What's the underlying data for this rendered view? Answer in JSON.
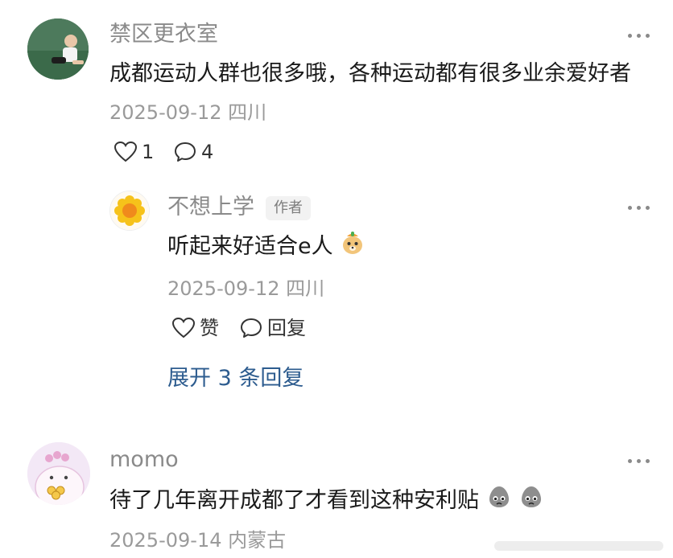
{
  "comments": [
    {
      "username": "禁区更衣室",
      "text": "成都运动人群也很多哦，各种运动都有很多业余爱好者",
      "meta": "2025-09-12 四川",
      "like_count": "1",
      "reply_count": "4"
    },
    {
      "username": "momo",
      "text": "待了几年离开成都了才看到这种安利贴",
      "meta": "2025-09-14 内蒙古"
    }
  ],
  "reply": {
    "username": "不想上学",
    "badge": "作者",
    "text": "听起来好适合e人",
    "meta": "2025-09-12 四川",
    "like_label": "赞",
    "reply_label": "回复"
  },
  "expand_label": "展开 3 条回复",
  "icons": {
    "more": "more-dots-icon",
    "like": "heart-outline-icon",
    "reply": "speech-bubble-icon"
  }
}
